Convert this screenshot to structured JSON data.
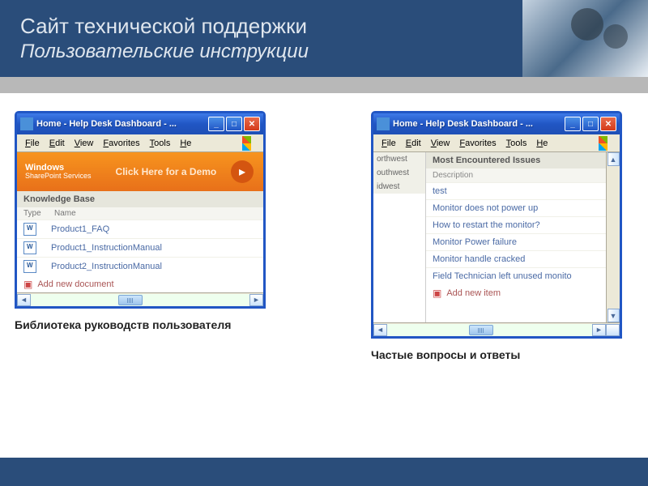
{
  "header": {
    "title": "Сайт технической поддержки",
    "subtitle": "Пользовательские инструкции"
  },
  "window1": {
    "title": "Home - Help Desk Dashboard - ...",
    "menu": [
      "File",
      "Edit",
      "View",
      "Favorites",
      "Tools",
      "He"
    ],
    "banner_brand1": "Windows",
    "banner_brand2": "SharePoint Services",
    "banner_text": "Click Here for a Demo",
    "panel_title": "Knowledge Base",
    "col_type": "Type",
    "col_name": "Name",
    "docs": [
      "Product1_FAQ",
      "Product1_InstructionManual",
      "Product2_InstructionManual"
    ],
    "add_label": "Add new document",
    "caption": "Библиотека руководств пользователя"
  },
  "window2": {
    "title": "Home - Help Desk Dashboard - ...",
    "menu": [
      "File",
      "Edit",
      "View",
      "Favorites",
      "Tools",
      "He"
    ],
    "sidebar": [
      "orthwest",
      "outhwest",
      "idwest"
    ],
    "panel_title": "Most Encountered Issues",
    "desc_header": "Description",
    "issues": [
      "test",
      "Monitor does not power up",
      "How to restart the monitor?",
      "Monitor Power failure",
      "Monitor handle cracked",
      "Field Technician left unused monito"
    ],
    "add_label": "Add new item",
    "caption": "Частые вопросы и ответы"
  }
}
